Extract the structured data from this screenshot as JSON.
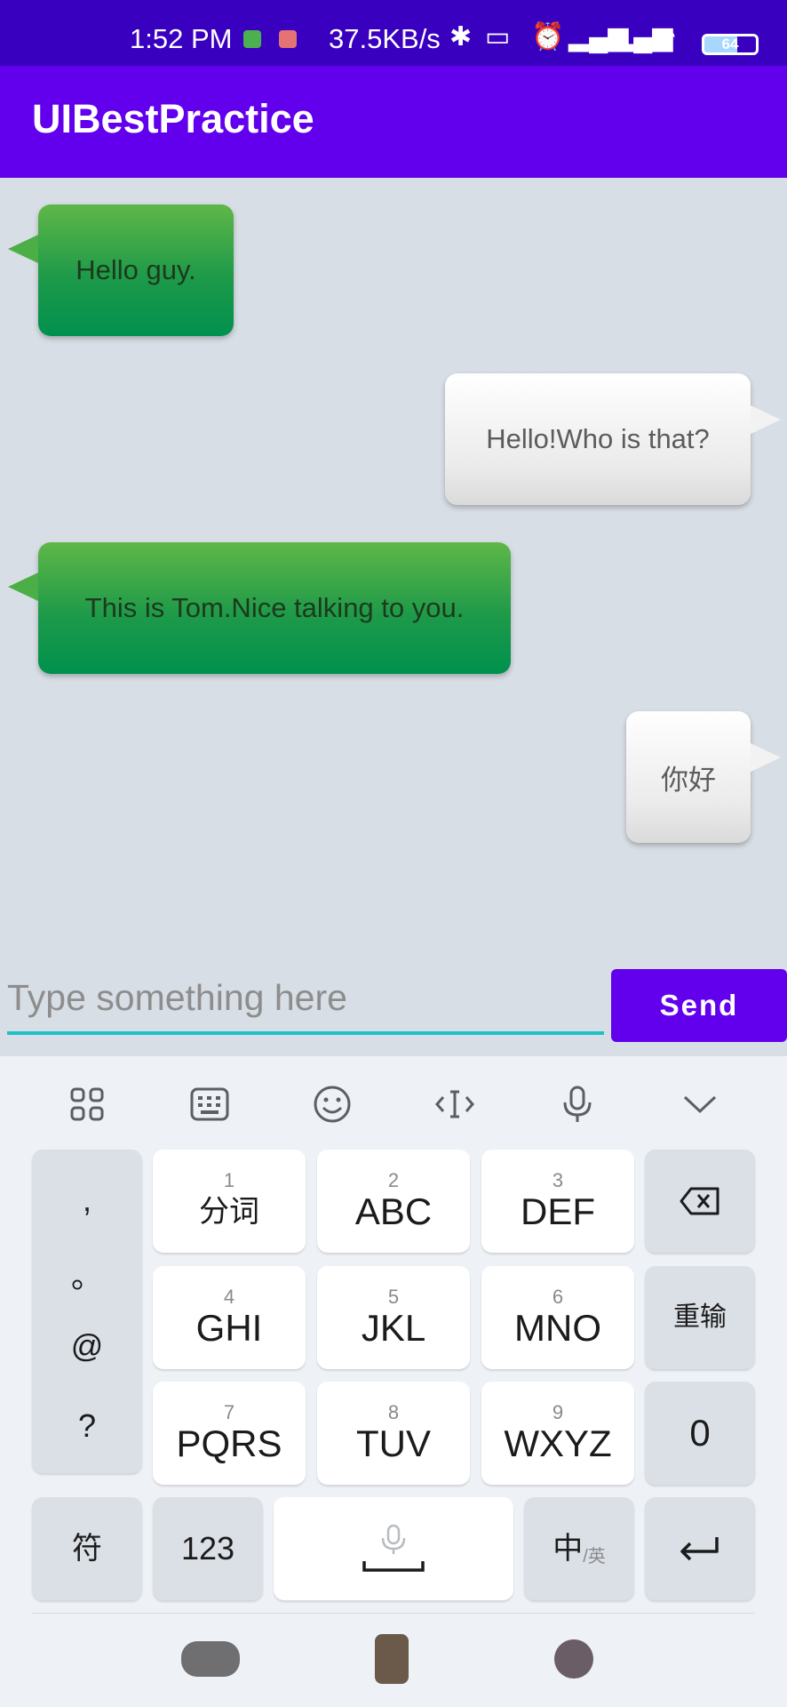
{
  "status_bar": {
    "time": "1:52 PM",
    "speed": "37.5KB/s",
    "battery": "64"
  },
  "app": {
    "title": "UIBestPractice"
  },
  "messages": [
    {
      "type": "received",
      "text": "Hello guy."
    },
    {
      "type": "sent",
      "text": "Hello!Who is that?"
    },
    {
      "type": "received",
      "text": "This is Tom.Nice talking to you."
    },
    {
      "type": "sent",
      "text": "你好"
    }
  ],
  "input": {
    "placeholder": "Type something here",
    "send_label": "Send"
  },
  "keyboard": {
    "symbols": [
      ",",
      "。",
      "@",
      "?"
    ],
    "keys": [
      {
        "num": "1",
        "label": "分词"
      },
      {
        "num": "2",
        "label": "ABC"
      },
      {
        "num": "3",
        "label": "DEF"
      },
      {
        "num": "4",
        "label": "GHI"
      },
      {
        "num": "5",
        "label": "JKL"
      },
      {
        "num": "6",
        "label": "MNO"
      },
      {
        "num": "7",
        "label": "PQRS"
      },
      {
        "num": "8",
        "label": "TUV"
      },
      {
        "num": "9",
        "label": "WXYZ"
      }
    ],
    "retype": "重输",
    "zero": "0",
    "fu": "符",
    "num123": "123",
    "zh": "中",
    "en": "/英"
  }
}
